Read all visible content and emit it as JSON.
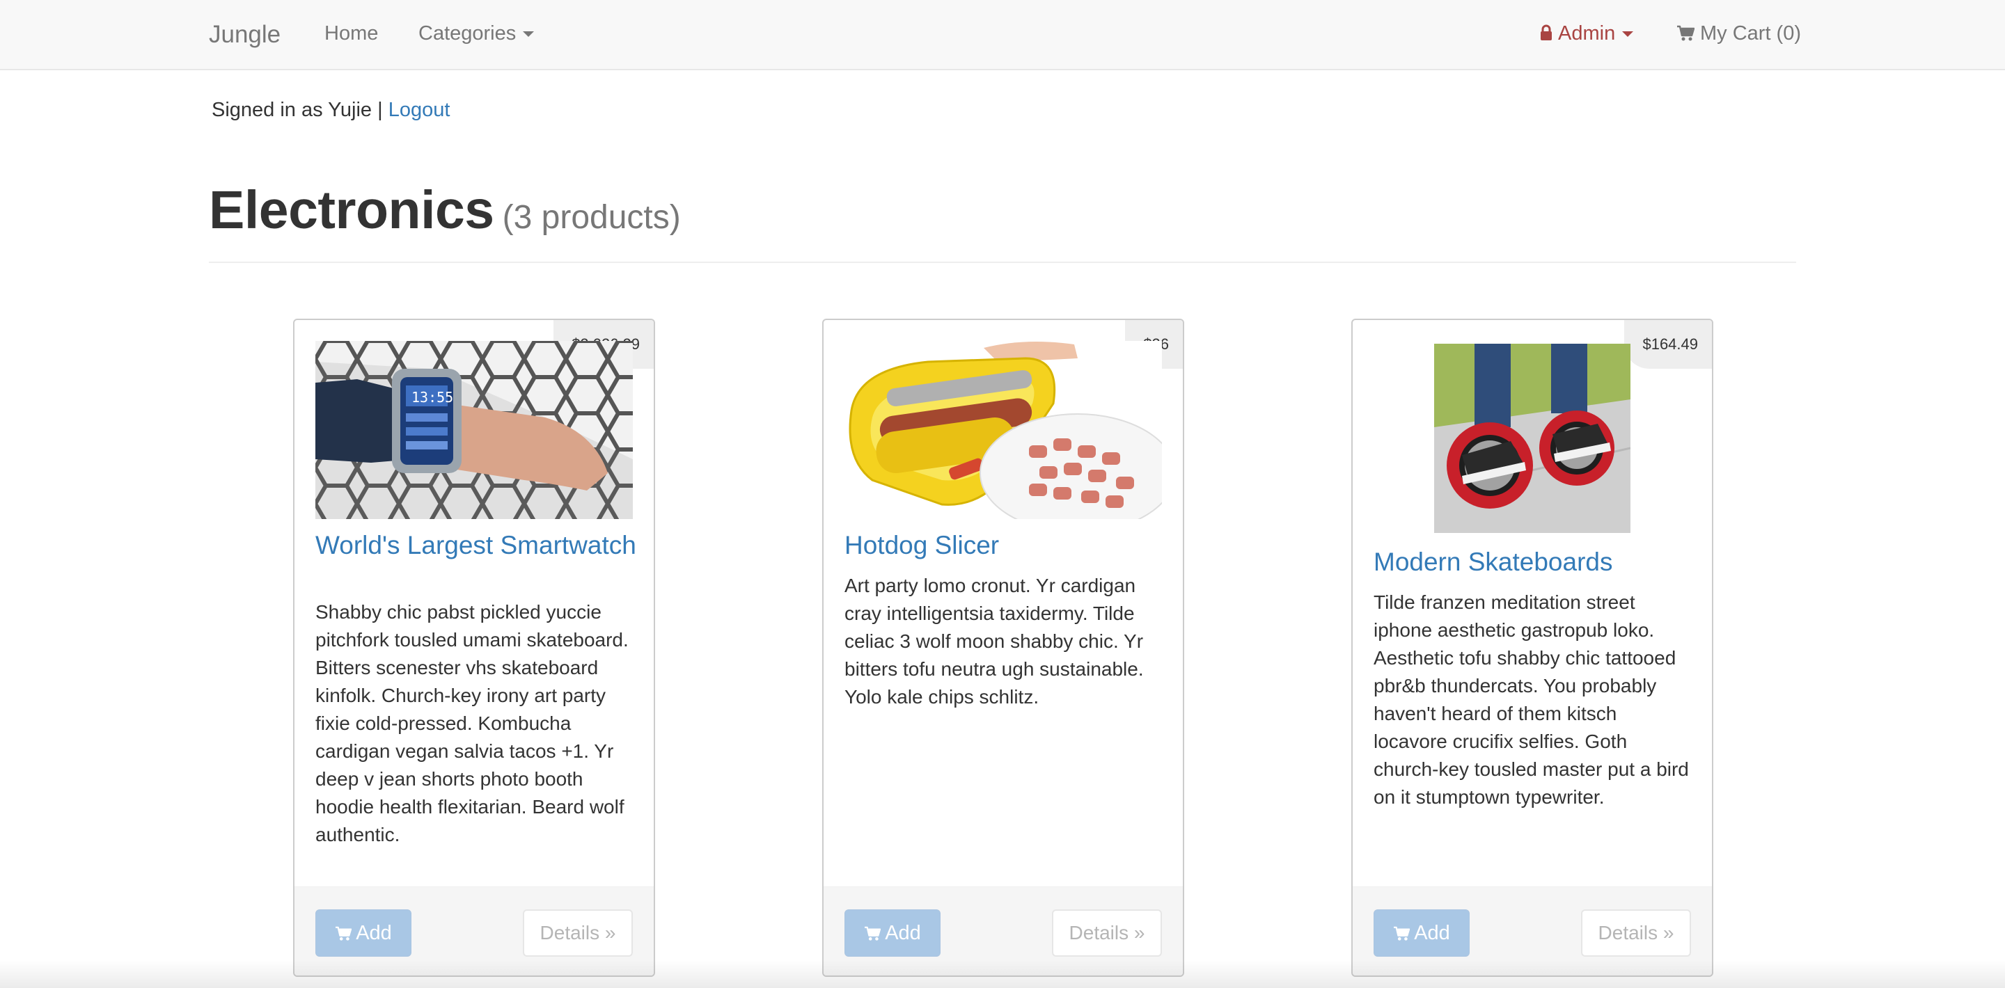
{
  "navbar": {
    "brand": "Jungle",
    "home": "Home",
    "categories": "Categories",
    "admin": "Admin",
    "cart": "My Cart (0)"
  },
  "session": {
    "signed_in_text": "Signed in as Yujie |",
    "logout": "Logout"
  },
  "page": {
    "title": "Electronics",
    "count": "(3 products)"
  },
  "products": [
    {
      "name": "World's Largest Smartwatch",
      "price": "$2,026.29",
      "description": "Shabby chic pabst pickled yuccie pitchfork tousled umami skateboard. Bitters scenester vhs skateboard kinfolk. Church-key irony art party fixie cold-pressed. Kombucha cardigan vegan salvia tacos +1. Yr deep v jean shorts photo booth hoodie health flexitarian. Beard wolf authentic.",
      "add_label": "Add",
      "details_label": "Details »"
    },
    {
      "name": "Hotdog Slicer",
      "price": "$26",
      "description": "Art party lomo cronut. Yr cardigan cray intelligentsia taxidermy. Tilde celiac 3 wolf moon shabby chic. Yr bitters tofu neutra ugh sustainable. Yolo kale chips schlitz.",
      "add_label": "Add",
      "details_label": "Details »"
    },
    {
      "name": "Modern Skateboards",
      "price": "$164.49",
      "description": "Tilde franzen meditation street iphone aesthetic gastropub loko. Aesthetic tofu shabby chic tattooed pbr&b thundercats. You probably haven't heard of them kitsch locavore crucifix selfies. Goth church-key tousled master put a bird on it stumptown typewriter.",
      "add_label": "Add",
      "details_label": "Details »"
    }
  ],
  "icons": {
    "lock": "lock-icon",
    "cart": "shopping-cart-icon",
    "caret": "caret-down-icon"
  },
  "colors": {
    "link": "#337ab7",
    "admin": "#a94442",
    "navbar_bg": "#f8f8f8",
    "add_button": "#a9c7e5"
  }
}
